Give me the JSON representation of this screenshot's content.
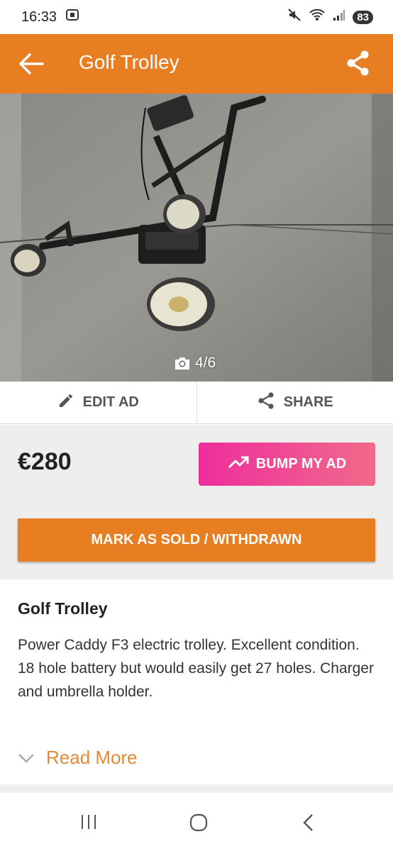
{
  "status_bar": {
    "time": "16:33",
    "battery": "83"
  },
  "app_bar": {
    "title": "Golf Trolley"
  },
  "gallery": {
    "counter": "4/6"
  },
  "actions": {
    "edit_label": "EDIT AD",
    "share_label": "SHARE"
  },
  "listing": {
    "price": "€280",
    "bump_label": "BUMP MY AD",
    "sold_label": "MARK AS SOLD / WITHDRAWN",
    "title": "Golf Trolley",
    "description": "Power Caddy F3 electric trolley. Excellent condition. 18 hole battery but would easily get 27 holes. Charger and umbrella holder.",
    "read_more": "Read More"
  },
  "colors": {
    "brand_orange": "#e87e22",
    "bump_gradient_start": "#ee2e9c",
    "bump_gradient_end": "#f06a8a"
  },
  "icons": [
    "back-arrow-icon",
    "share-icon",
    "camera-icon",
    "pencil-icon",
    "trending-up-icon",
    "chevron-down-icon",
    "recents-icon",
    "home-icon",
    "back-icon"
  ]
}
